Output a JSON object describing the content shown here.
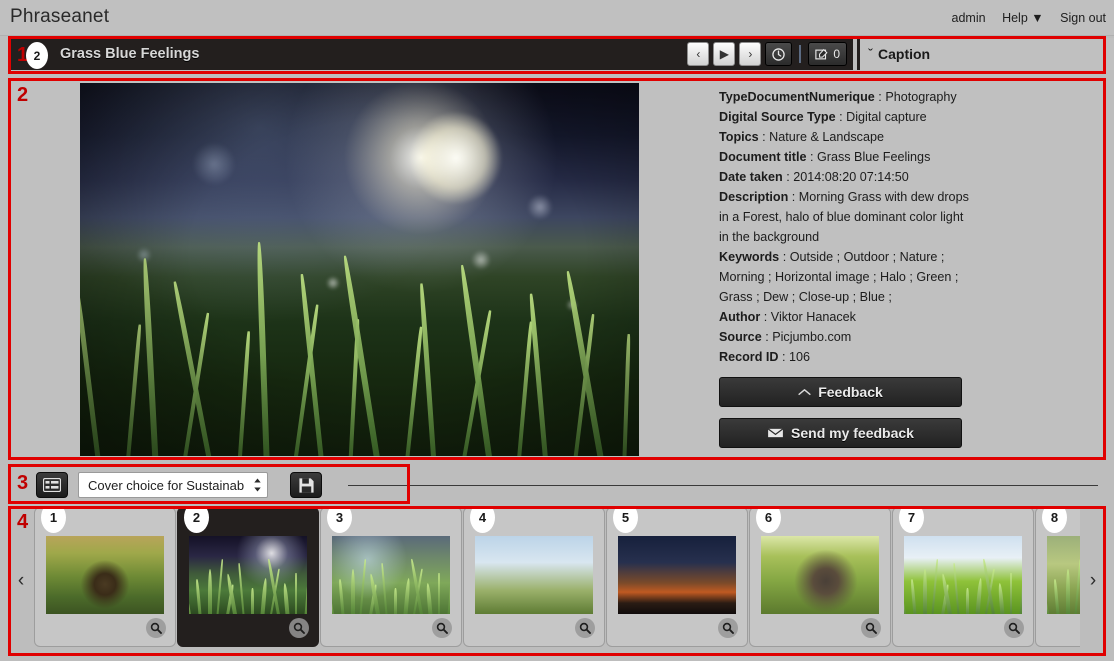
{
  "header": {
    "brand": "Phraseanet",
    "user": "admin",
    "help_label": "Help",
    "help_caret": "▼",
    "signout_label": "Sign out"
  },
  "titlebar": {
    "record_title": "Grass Blue Feelings",
    "badge_number": "2",
    "prev_label": "‹",
    "play_label": "▶",
    "next_label": "›",
    "status_icon": "clock-icon",
    "edit_count": "0"
  },
  "caption_panel": {
    "label": "Caption",
    "caret": "ˇ"
  },
  "metadata": {
    "fields": [
      {
        "label": "TypeDocumentNumerique",
        "value": "Photography"
      },
      {
        "label": "Digital Source Type",
        "value": "Digital capture"
      },
      {
        "label": "Topics",
        "value": "Nature & Landscape"
      },
      {
        "label": "Document title",
        "value": "Grass Blue Feelings"
      },
      {
        "label": "Date taken",
        "value": "2014:08:20 07:14:50"
      },
      {
        "label": "Description",
        "value": "Morning Grass with dew drops"
      }
    ],
    "description_cont_1": "in a Forest, halo of blue dominant color light",
    "description_cont_2": "in the background",
    "keywords_label": "Keywords",
    "keywords_value": "Outside ; Outdoor ; Nature ;",
    "keywords_cont_1": "Morning ; Horizontal image ; Halo ; Green ;",
    "keywords_cont_2": "Grass ; Dew ; Close-up ; Blue ;",
    "author_label": "Author",
    "author_value": "Viktor Hanacek",
    "source_label": "Source",
    "source_value": "Picjumbo.com",
    "recordid_label": "Record ID",
    "recordid_value": "106"
  },
  "feedback": {
    "title": "Feedback",
    "title_icon": "caret-up-icon",
    "send_label": "Send my feedback",
    "send_icon": "envelope-icon"
  },
  "toolstrip": {
    "list_icon": "list-icon",
    "story_selected": "Cover choice for Sustainab",
    "stepper_icon": "updown-arrows-icon",
    "save_icon": "floppy-disk-icon"
  },
  "basket": {
    "prev_arrow": "‹",
    "next_arrow": "›",
    "zoom_icon": "magnifier-icon",
    "thumbs": [
      {
        "num": "1",
        "art": "tn-pine",
        "selected": false
      },
      {
        "num": "2",
        "art": "tn-grass-dew",
        "selected": true
      },
      {
        "num": "3",
        "art": "tn-dew2",
        "selected": false
      },
      {
        "num": "4",
        "art": "tn-tulip",
        "selected": false
      },
      {
        "num": "5",
        "art": "tn-sunset",
        "selected": false
      },
      {
        "num": "6",
        "art": "tn-forest",
        "selected": false
      },
      {
        "num": "7",
        "art": "tn-wheat",
        "selected": false
      },
      {
        "num": "8",
        "art": "tn-sun",
        "selected": false
      }
    ]
  },
  "annotations": {
    "one": "1",
    "two": "2",
    "three": "3",
    "four": "4",
    "color": "#e00000"
  }
}
